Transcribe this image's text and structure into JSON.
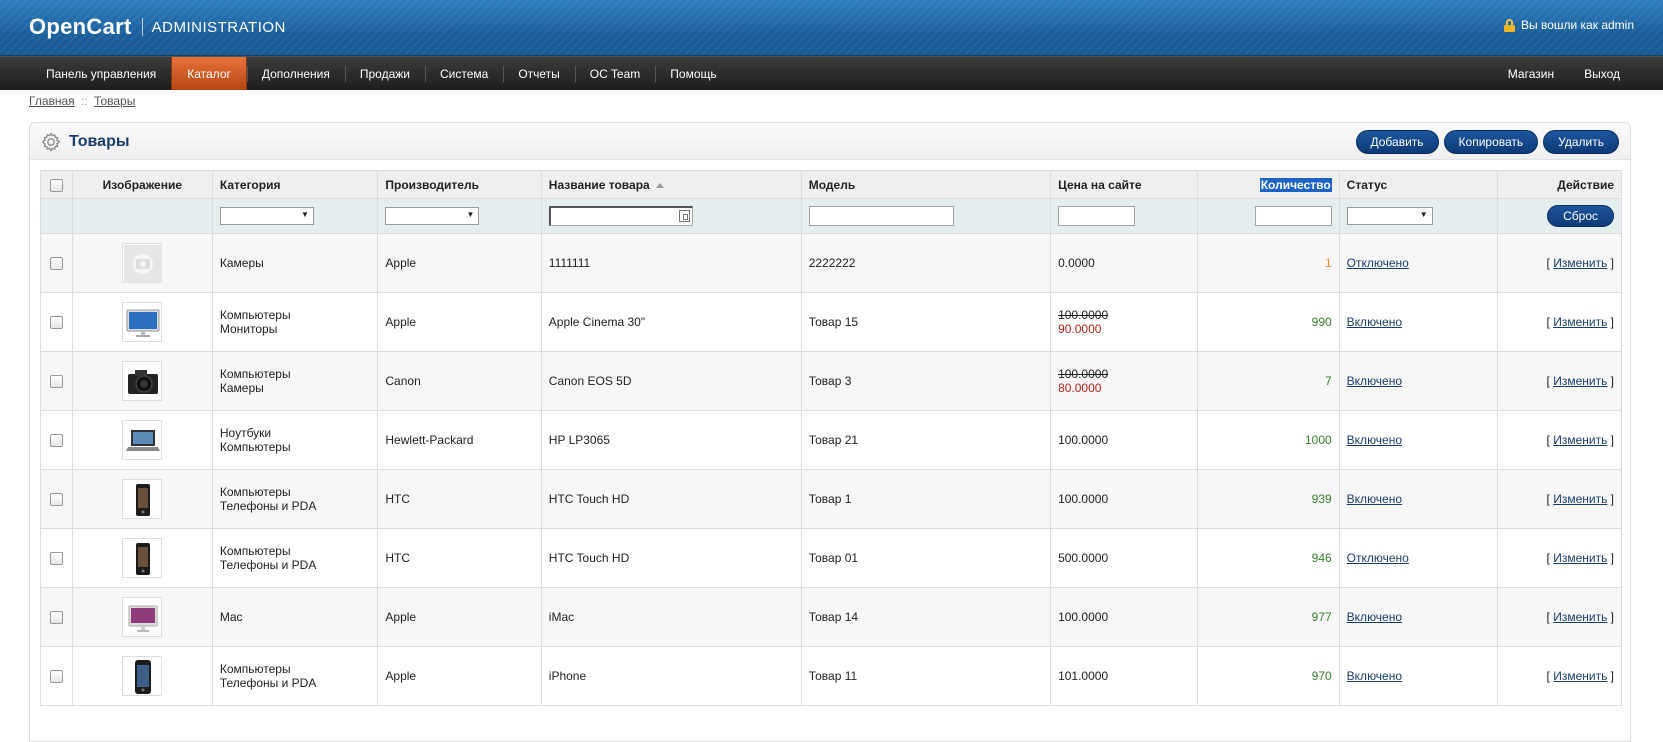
{
  "header": {
    "brand": "OpenCart",
    "subtitle": "ADMINISTRATION",
    "logged_in": "Вы вошли как admin"
  },
  "menu": {
    "left": [
      {
        "label": "Панель управления",
        "active": false
      },
      {
        "label": "Каталог",
        "active": true
      },
      {
        "label": "Дополнения",
        "active": false
      },
      {
        "label": "Продажи",
        "active": false
      },
      {
        "label": "Система",
        "active": false
      },
      {
        "label": "Отчеты",
        "active": false
      },
      {
        "label": "OC Team",
        "active": false
      },
      {
        "label": "Помощь",
        "active": false
      }
    ],
    "right": [
      {
        "label": "Магазин"
      },
      {
        "label": "Выход"
      }
    ]
  },
  "breadcrumb": {
    "home": "Главная",
    "separator": "::",
    "current": "Товары"
  },
  "box": {
    "title": "Товары",
    "buttons": {
      "add": "Добавить",
      "copy": "Копировать",
      "delete": "Удалить"
    }
  },
  "table": {
    "headers": {
      "image": "Изображение",
      "category": "Категория",
      "manufacturer": "Производитель",
      "name": "Название товара",
      "model": "Модель",
      "price": "Цена на сайте",
      "quantity": "Количество",
      "status": "Статус",
      "action": "Действие"
    },
    "filter": {
      "reset": "Сброс",
      "category_value": "",
      "manufacturer_value": "",
      "name_value": "",
      "model_value": "",
      "price_value": "",
      "quantity_value": "",
      "status_value": ""
    },
    "edit_label": "Изменить",
    "rows": [
      {
        "image": "placeholder",
        "categories": [
          "Камеры"
        ],
        "manufacturer": "Apple",
        "name": "1111111",
        "model": "2222222",
        "price": "0.0000",
        "special": "",
        "quantity": "1",
        "qty_low": true,
        "status": "Отключено"
      },
      {
        "image": "monitor",
        "categories": [
          "Компьютеры",
          "Мониторы"
        ],
        "manufacturer": "Apple",
        "name": "Apple Cinema 30\"",
        "model": "Товар 15",
        "price": "100.0000",
        "special": "90.0000",
        "quantity": "990",
        "qty_low": false,
        "status": "Включено"
      },
      {
        "image": "camera",
        "categories": [
          "Компьютеры",
          "Камеры"
        ],
        "manufacturer": "Canon",
        "name": "Canon EOS 5D",
        "model": "Товар 3",
        "price": "100.0000",
        "special": "80.0000",
        "quantity": "7",
        "qty_low": false,
        "status": "Включено"
      },
      {
        "image": "laptop",
        "categories": [
          "Ноутбуки",
          "Компьютеры"
        ],
        "manufacturer": "Hewlett-Packard",
        "name": "HP LP3065",
        "model": "Товар 21",
        "price": "100.0000",
        "special": "",
        "quantity": "1000",
        "qty_low": false,
        "status": "Включено"
      },
      {
        "image": "phone",
        "categories": [
          "Компьютеры",
          "Телефоны и PDA"
        ],
        "manufacturer": "HTC",
        "name": "HTC Touch HD",
        "model": "Товар 1",
        "price": "100.0000",
        "special": "",
        "quantity": "939",
        "qty_low": false,
        "status": "Включено"
      },
      {
        "image": "phone",
        "categories": [
          "Компьютеры",
          "Телефоны и PDA"
        ],
        "manufacturer": "HTC",
        "name": "HTC Touch HD",
        "model": "Товар 01",
        "price": "500.0000",
        "special": "",
        "quantity": "946",
        "qty_low": false,
        "status": "Отключено"
      },
      {
        "image": "imac",
        "categories": [
          "Mac"
        ],
        "manufacturer": "Apple",
        "name": "iMac",
        "model": "Товар 14",
        "price": "100.0000",
        "special": "",
        "quantity": "977",
        "qty_low": false,
        "status": "Включено"
      },
      {
        "image": "iphone",
        "categories": [
          "Компьютеры",
          "Телефоны и PDA"
        ],
        "manufacturer": "Apple",
        "name": "iPhone",
        "model": "Товар 11",
        "price": "101.0000",
        "special": "",
        "quantity": "970",
        "qty_low": false,
        "status": "Включено"
      }
    ]
  },
  "colors": {
    "header_blue": "#1e65a5",
    "menu_active": "#d35c24",
    "button_blue": "#14478a",
    "qty_green": "#3a7d2e",
    "qty_orange": "#e88a2e",
    "special_red": "#b0221c",
    "link_blue": "#1a3e6b"
  }
}
